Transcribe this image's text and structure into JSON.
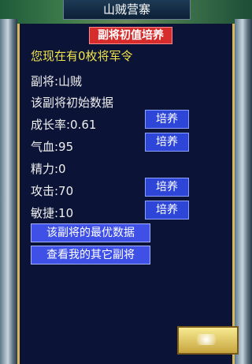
{
  "window": {
    "title": "山贼营寨"
  },
  "header": {
    "badge": "副将初值培养"
  },
  "info": {
    "token_line": "您现在有0枚将军令",
    "general_line": "副将:山贼",
    "initial_data_line": "该副将初始数据"
  },
  "stats": [
    {
      "label": "成长率:0.61",
      "button": "培养"
    },
    {
      "label": "气血:95",
      "button": "培养"
    },
    {
      "label": "精力:0",
      "button": null
    },
    {
      "label": "攻击:70",
      "button": "培养"
    },
    {
      "label": "敏捷:10",
      "button": "培养"
    }
  ],
  "actions": {
    "best_data": "该副将的最优数据",
    "view_others": "查看我的其它副将"
  },
  "colors": {
    "badge": "#d62c2c",
    "button": "#2d46d8",
    "panel": "#0b1336",
    "highlight_text": "#f2e44a"
  }
}
